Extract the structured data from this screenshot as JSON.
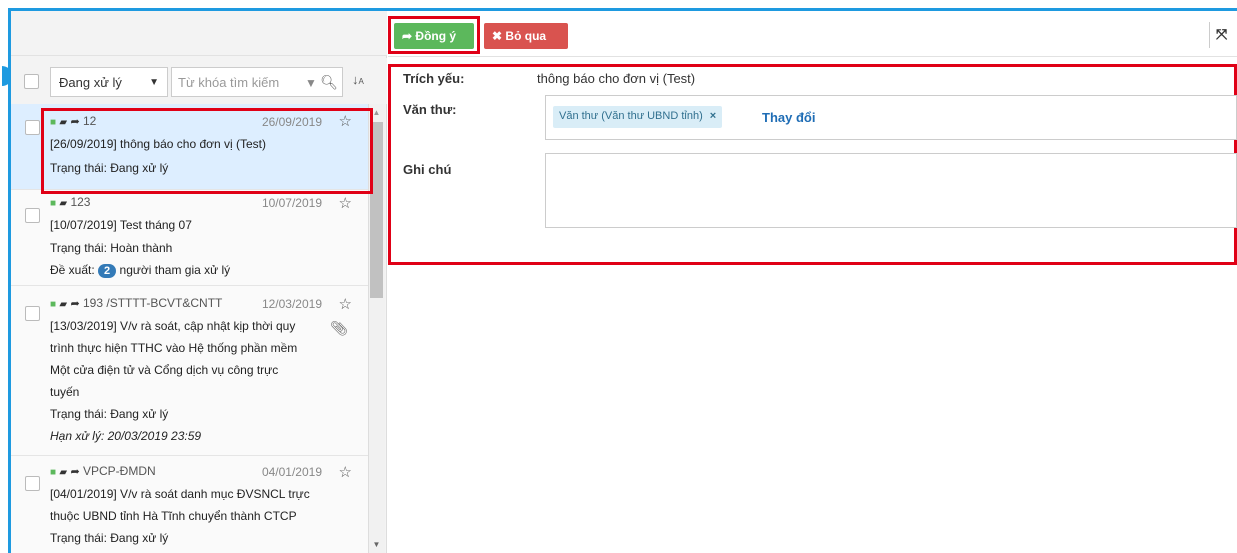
{
  "toolbar": {
    "agree_label": "Đồng ý",
    "skip_label": "Bỏ qua"
  },
  "filter": {
    "status_value": "Đang xử lý",
    "search_placeholder": "Từ khóa tìm kiếm"
  },
  "items": [
    {
      "number": "12",
      "date": "26/09/2019",
      "title": "[26/09/2019] thông báo cho đơn vị (Test)",
      "status": "Trạng thái: Đang xử lý"
    },
    {
      "number": "123",
      "date": "10/07/2019",
      "title": "[10/07/2019] Test tháng 07",
      "status": "Trạng thái: Hoàn thành",
      "proposal_prefix": "Đề xuất:",
      "proposal_count": "2",
      "proposal_suffix": "người tham gia xử lý"
    },
    {
      "number": "193 /STTTT-BCVT&CNTT",
      "date": "12/03/2019",
      "title_lines": [
        "[13/03/2019] V/v rà soát, cập nhật kịp thời quy",
        "trình thực hiện TTHC vào Hệ thống phần mềm",
        "Một cửa điện tử và Cổng dịch vụ công trực",
        "tuyến"
      ],
      "status": "Trạng thái: Đang xử lý",
      "deadline": "Hạn xử lý: 20/03/2019 23:59"
    },
    {
      "number": "VPCP-ĐMDN",
      "date": "04/01/2019",
      "title_lines": [
        "[04/01/2019] V/v rà soát danh mục ĐVSNCL trực",
        "thuộc UBND tỉnh Hà Tĩnh chuyển thành CTCP"
      ],
      "status": "Trạng thái: Đang xử lý"
    }
  ],
  "form": {
    "summary_label": "Trích yếu:",
    "summary_value": "thông báo cho đơn vị (Test)",
    "clerk_label": "Văn thư:",
    "clerk_tag": "Văn thư (Văn thư UBND tỉnh)",
    "change_label": "Thay đổi",
    "note_label": "Ghi chú"
  }
}
